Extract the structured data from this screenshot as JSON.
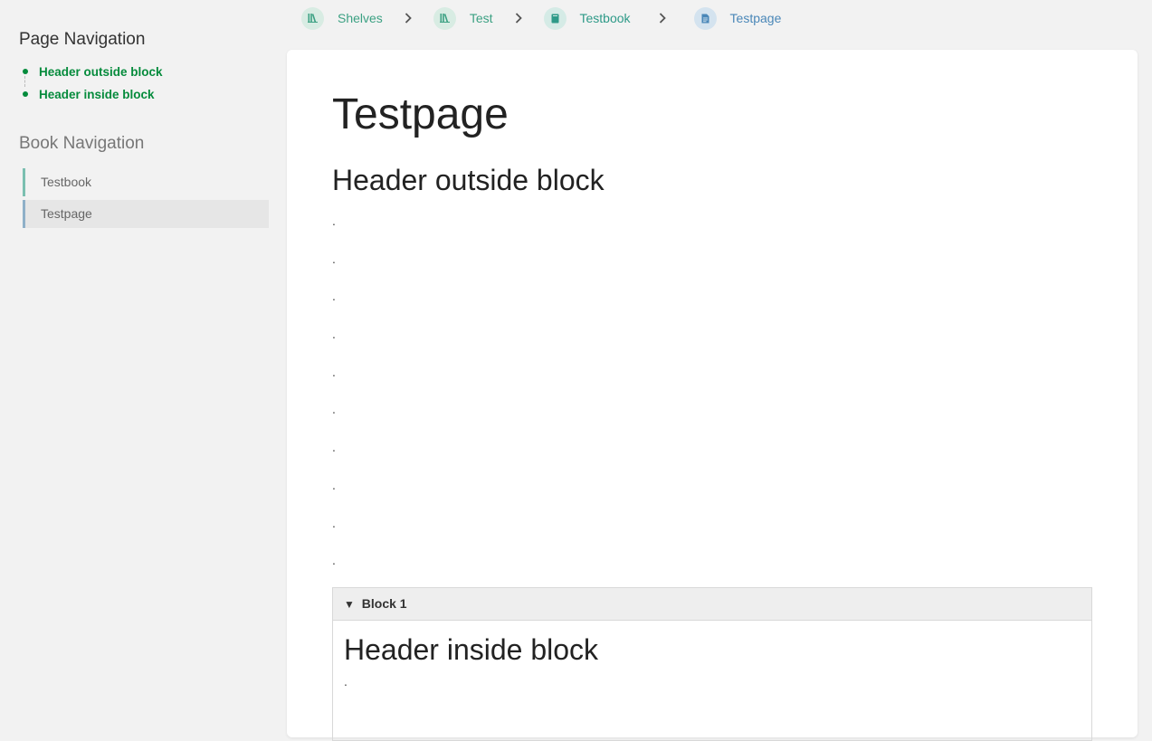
{
  "sidebar": {
    "page_nav_heading": "Page Navigation",
    "page_nav_items": [
      "Header outside block",
      "Header inside block"
    ],
    "book_nav_heading": "Book Navigation",
    "book_nav_items": [
      "Testbook",
      "Testpage"
    ]
  },
  "breadcrumb": {
    "items": [
      "Shelves",
      "Test",
      "Testbook",
      "Testpage"
    ]
  },
  "content": {
    "title": "Testpage",
    "header_outside": "Header outside block",
    "dots": [
      ".",
      ".",
      ".",
      ".",
      ".",
      ".",
      ".",
      ".",
      ".",
      "."
    ],
    "block": {
      "summary_label": "Block 1",
      "header_inside": "Header inside block",
      "dot": "."
    }
  },
  "colors": {
    "accent_green": "#058b3c",
    "book_color": "#2e9a88",
    "page_color": "#4a87b8",
    "shelf_color": "#3ca183"
  }
}
